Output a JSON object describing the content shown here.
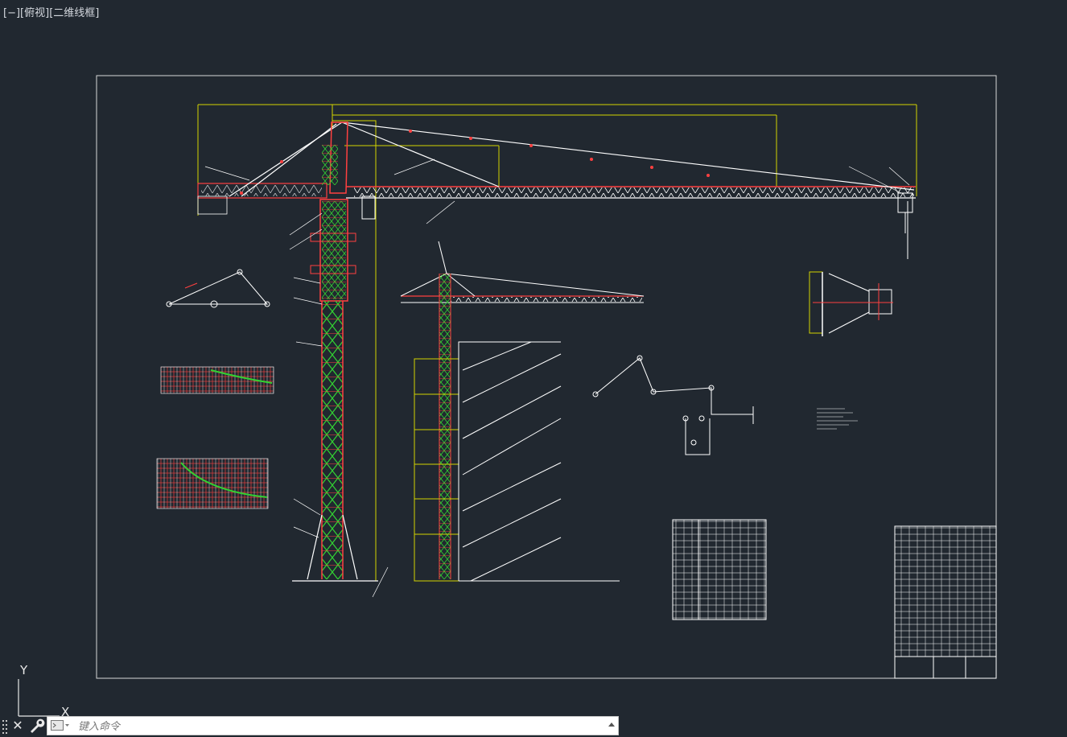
{
  "viewport": {
    "bracket": "[−]",
    "view": "[俯视]",
    "visual_style": "[二维线框]"
  },
  "ucs": {
    "y_label": "Y",
    "x_label": "X"
  },
  "command_line": {
    "placeholder": "键入命令",
    "close_icon": "close-icon",
    "customize_icon": "wrench-icon",
    "history_icon": "chevron-up-icon"
  },
  "colors": {
    "background": "#212830",
    "frame": "#d8d8d8",
    "dimension": "#d4d400",
    "structure": "#ff4040",
    "member": "#32d232",
    "white": "#ffffff"
  }
}
